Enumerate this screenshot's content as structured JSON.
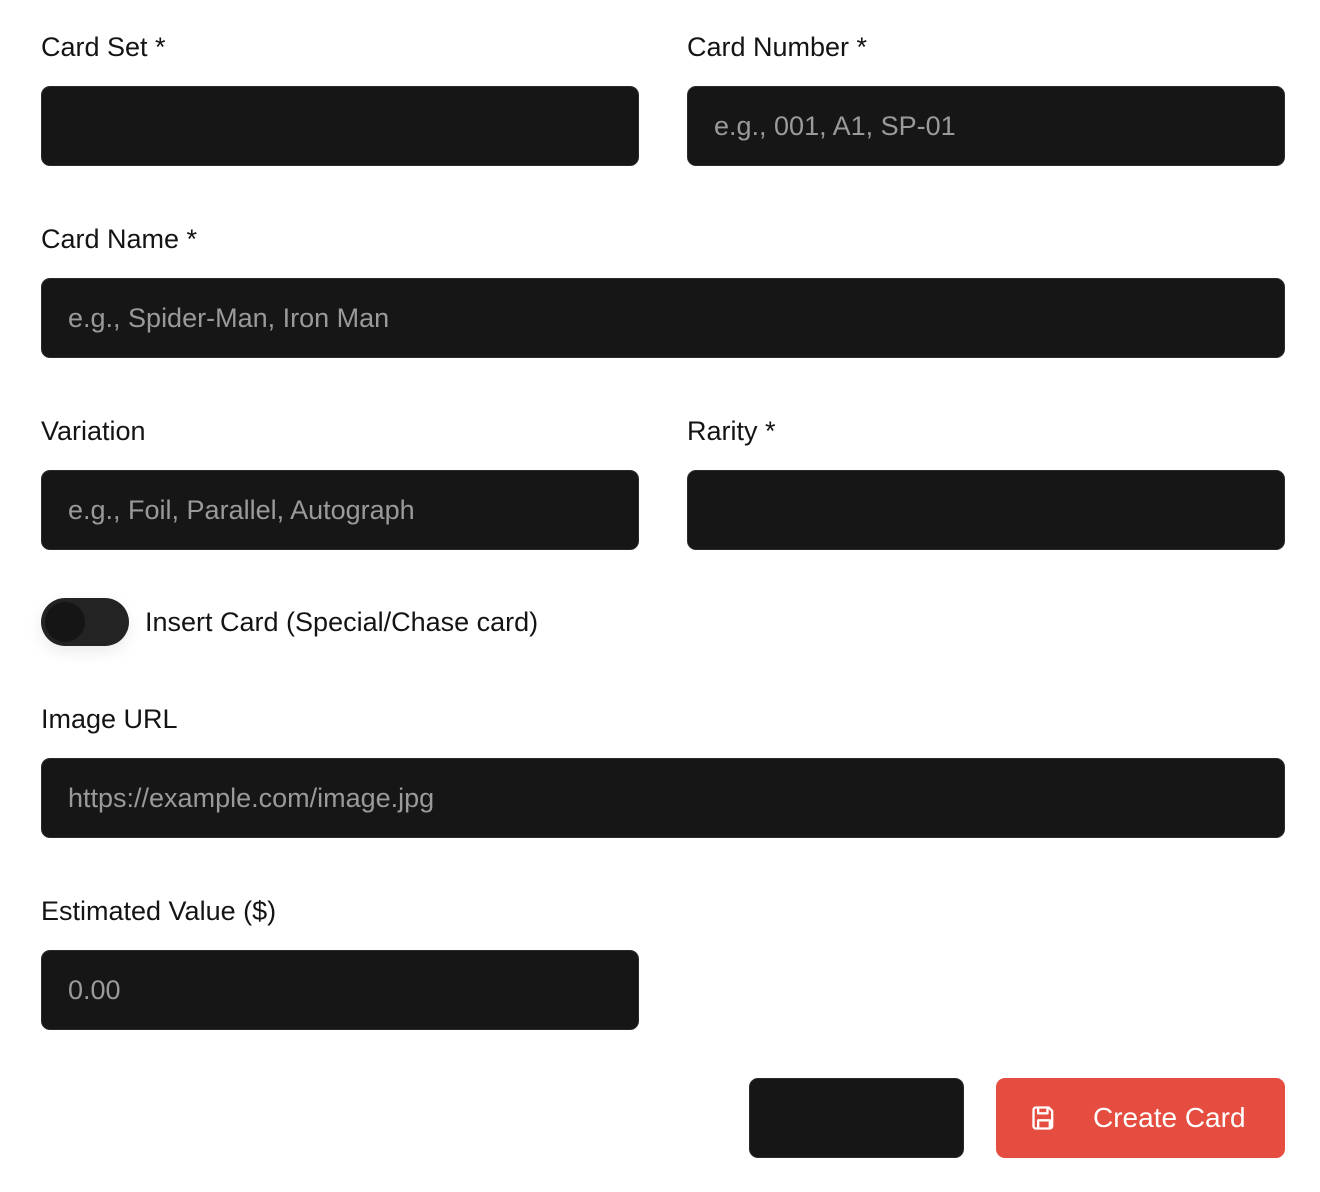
{
  "form": {
    "card_set": {
      "label": "Card Set *",
      "value": ""
    },
    "card_number": {
      "label": "Card Number *",
      "placeholder": "e.g., 001, A1, SP-01",
      "value": ""
    },
    "card_name": {
      "label": "Card Name *",
      "placeholder": "e.g., Spider-Man, Iron Man",
      "value": ""
    },
    "variation": {
      "label": "Variation",
      "placeholder": "e.g., Foil, Parallel, Autograph",
      "value": ""
    },
    "rarity": {
      "label": "Rarity *",
      "value": ""
    },
    "insert_card": {
      "label": "Insert Card (Special/Chase card)",
      "checked": false
    },
    "image_url": {
      "label": "Image URL",
      "placeholder": "https://example.com/image.jpg",
      "value": ""
    },
    "estimated_value": {
      "label": "Estimated Value ($)",
      "placeholder": "0.00",
      "value": ""
    }
  },
  "actions": {
    "cancel_label": "",
    "create_label": "Create Card",
    "create_icon": "save-icon"
  },
  "colors": {
    "field_bg": "#161616",
    "primary": "#e44d3f",
    "text": "#141414",
    "placeholder": "#9a9a9a"
  }
}
